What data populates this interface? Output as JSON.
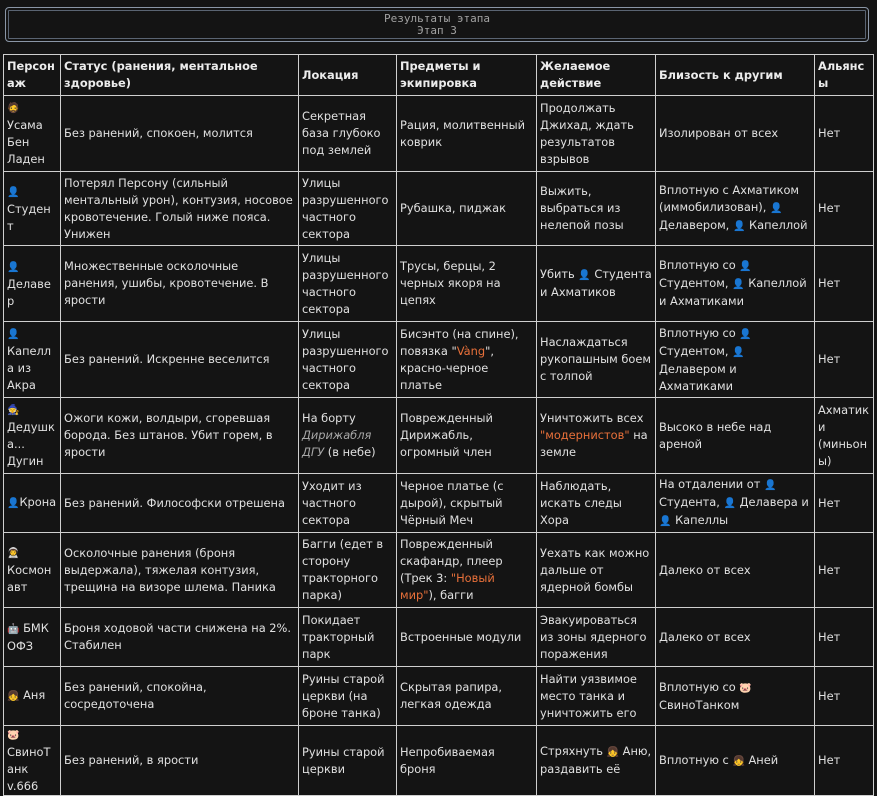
{
  "header": {
    "line1": "Результаты этапа",
    "line2": "Этап 3"
  },
  "table": {
    "headers": [
      "Персонаж",
      "Статус (ранения, ментальное здоровье)",
      "Локация",
      "Предметы и экипировка",
      "Желаемое действие",
      "Близость к другим",
      "Альянсы"
    ],
    "rows": [
      {
        "icon": "🧔",
        "name": "Усама Бен Ладен",
        "status": "Без ранений, спокоен, молится",
        "loc": "Секретная база глубоко под землей",
        "items": "Рация, молитвенный коврик",
        "action": "Продолжать Джихад, ждать результатов взрывов",
        "prox": "Изолирован от всех",
        "ally": "Нет"
      },
      {
        "icon": "👤",
        "name": "Студент",
        "status": "Потерял Персону (сильный ментальный урон), контузия, носовое кровотечение. Голый ниже пояса. Унижен",
        "loc": "Улицы разрушенного частного сектора",
        "items": "Рубашка, пиджак",
        "action": "Выжить, выбраться из нелепой позы",
        "prox_a": "Вплотную с Ахматиком (иммобилизован), ",
        "prox_b": "Делавером, ",
        "prox_c": "Капеллой",
        "ally": "Нет"
      },
      {
        "icon": "👤",
        "name": "Делавер",
        "status": "Множественные осколочные ранения, ушибы, кровотечение. В ярости",
        "loc": "Улицы разрушенного частного сектора",
        "items": "Трусы, берцы, 2 черных якоря на цепях",
        "action_a": "Убить ",
        "action_b": "Студента и Ахматиков",
        "prox_a": "Вплотную со ",
        "prox_b": "Студентом, ",
        "prox_c": "Капеллой и Ахматиками",
        "ally": "Нет"
      },
      {
        "icon": "👤",
        "name": "Капелла из Акра",
        "status": "Без ранений. Искренне веселится",
        "loc": "Улицы разрушенного частного сектора",
        "items_a": "Бисэнто (на спине), повязка \"",
        "items_hl": "Vàng",
        "items_b": "\", красно-черное платье",
        "action": "Наслаждаться рукопашным боем с толпой",
        "prox_a": "Вплотную со ",
        "prox_b": "Студентом, ",
        "prox_c": "Делавером и Ахматиками",
        "ally": "Нет"
      },
      {
        "icon": "🧙",
        "name": "Дедушка... Дугин",
        "status": "Ожоги кожи, волдыри, сгоревшая борода. Без штанов. Убит горем, в ярости",
        "loc_a": "На борту ",
        "loc_it": "Дирижабля ДГУ",
        "loc_b": " (в небе)",
        "items": "Поврежденный Дирижабль, огромный член",
        "action_a": "Уничтожить всех ",
        "action_hl": "\"модернистов\"",
        "action_b": " на земле",
        "prox": "Высоко в небе над ареной",
        "ally": "Ахматик и (миньоны)"
      },
      {
        "icon": "👤",
        "name": "Крона",
        "status": "Без ранений. Философски отрешена",
        "loc": "Уходит из частного сектора",
        "items": "Черное платье (с дырой), скрытый Чёрный Меч",
        "action": "Наблюдать, искать следы Хора",
        "prox_a": "На отдалении от ",
        "prox_b": "Студента, ",
        "prox_c": "Делавера и ",
        "prox_d": "Капеллы",
        "ally": "Нет"
      },
      {
        "icon": "👨‍🚀",
        "name": "Космонавт",
        "status": "Осколочные ранения (броня выдержала), тяжелая контузия, трещина на визоре шлема. Паника",
        "loc": "Багги (едет в сторону тракторного парка)",
        "items_a": "Поврежденный скафандр, плеер (Трек 3: ",
        "items_hl": "\"Новый мир\"",
        "items_b": "), багги",
        "action": "Уехать как можно дальше от ядерной бомбы",
        "prox": "Далеко от всех",
        "ally": "Нет"
      },
      {
        "icon": "🤖",
        "name": "БМК ОФЗ",
        "status": "Броня ходовой части снижена на 2%. Стабилен",
        "loc": "Покидает тракторный парк",
        "items": "Встроенные модули",
        "action": "Эвакуироваться из зоны ядерного поражения",
        "prox": "Далеко от всех",
        "ally": "Нет"
      },
      {
        "icon": "👧",
        "name": "Аня",
        "status": "Без ранений, спокойна, сосредоточена",
        "loc": "Руины старой церкви (на броне танка)",
        "items": "Скрытая рапира, легкая одежда",
        "action": "Найти уязвимое место танка и уничтожить его",
        "prox_a": "Вплотную со ",
        "prox_b": "СвиноТанком",
        "ally": "Нет"
      },
      {
        "icon": "🐷",
        "name": "СвиноТанк v.666",
        "status": "Без ранений, в ярости",
        "loc": "Руины старой церкви",
        "items": "Непробиваемая броня",
        "action_a": "Стряхнуть ",
        "action_b": "Аню, раздавить её",
        "prox_a": "Вплотную с ",
        "prox_b": "Аней",
        "ally": "Нет"
      }
    ]
  }
}
